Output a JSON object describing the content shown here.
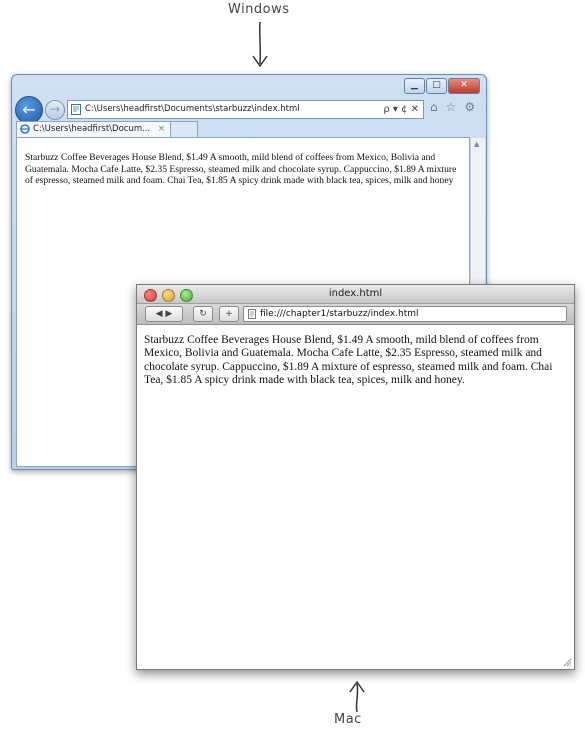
{
  "labels": {
    "windows": "Windows",
    "mac": "Mac"
  },
  "windows_browser": {
    "address_url": "C:\\Users\\headfirst\\Documents\\starbuzz\\index.html",
    "address_controls": "ρ ▾ ¢ ✕",
    "tab_title": "C:\\Users\\headfirst\\Docum...",
    "tab_close": "×",
    "page_text": "Starbuzz Coffee Beverages House Blend, $1.49 A smooth, mild blend of coffees from Mexico, Bolivia and Guatemala. Mocha Cafe Latte, $2.35 Espresso, steamed milk and chocolate syrup. Cappuccino, $1.89 A mixture of espresso, steamed milk and foam. Chai Tea, $1.85 A spicy drink made with black tea, spices, milk and honey",
    "accent": "#1e5aa8"
  },
  "mac_browser": {
    "window_title": "index.html",
    "address_url": "file:///chapter1/starbuzz/index.html",
    "page_text": "Starbuzz Coffee Beverages House Blend, $1.49 A smooth, mild blend of coffees from Mexico, Bolivia and Guatemala. Mocha Cafe Latte, $2.35 Espresso, steamed milk and chocolate syrup. Cappuccino, $1.89 A mixture of espresso, steamed milk and foam. Chai Tea, $1.85 A spicy drink made with black tea, spices, milk and honey."
  },
  "icons": [
    "down-arrow-icon",
    "up-arrow-icon",
    "back-icon",
    "forward-icon",
    "page-icon",
    "ie-icon",
    "home-icon",
    "star-icon",
    "gear-icon",
    "reload-icon",
    "add-bookmark-icon",
    "resize-grip-icon"
  ]
}
